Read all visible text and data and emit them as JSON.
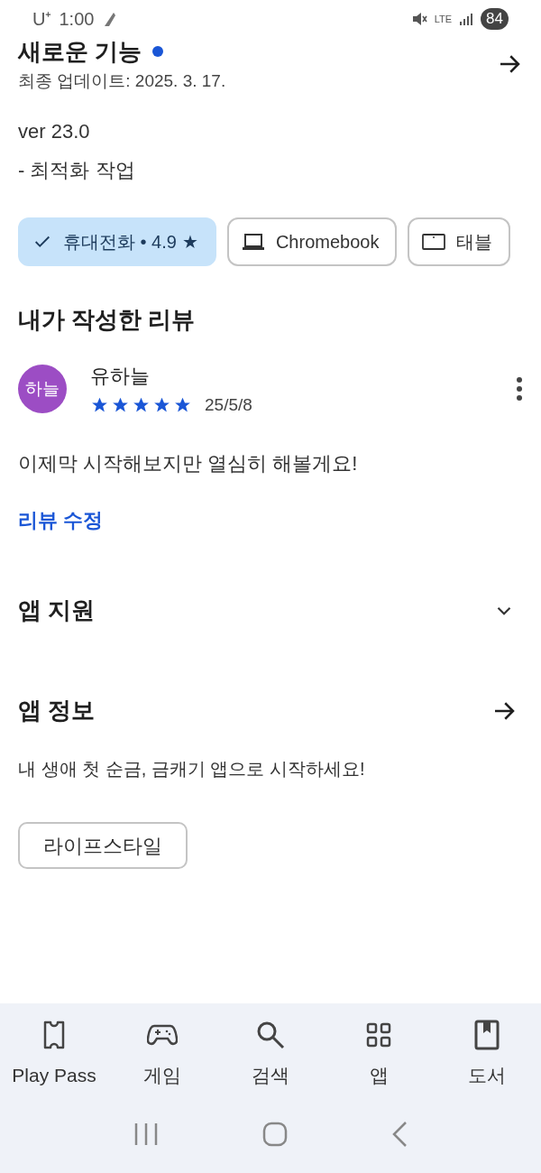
{
  "status_bar": {
    "carrier": "U⁺",
    "time": "1:00",
    "network": "LTE",
    "battery": "84"
  },
  "whats_new": {
    "title": "새로운 기능",
    "unread": true,
    "updated": "최종 업데이트: 2025. 3. 17.",
    "version": "ver 23.0",
    "notes": "- 최적화 작업"
  },
  "devices": [
    {
      "kind": "phone",
      "label": "휴대전화 • 4.9",
      "rating_star": "★",
      "selected": true
    },
    {
      "kind": "laptop",
      "label": "Chromebook",
      "selected": false
    },
    {
      "kind": "tablet",
      "label": "태블",
      "selected": false
    }
  ],
  "my_review": {
    "heading": "내가 작성한 리뷰",
    "avatar": "하늘",
    "author": "유하늘",
    "stars": 5,
    "date": "25/5/8",
    "text": "이제막 시작해보지만 열심히 해볼게요!",
    "edit_link": "리뷰 수정"
  },
  "app_support": {
    "heading": "앱 지원",
    "expanded": false
  },
  "app_info": {
    "heading": "앱 정보",
    "description": "내 생애 첫 순금, 금캐기 앱으로 시작하세요!",
    "tag": "라이프스타일"
  },
  "bottom_nav": [
    {
      "kind": "pass",
      "label": "Play Pass",
      "selected": false
    },
    {
      "kind": "games",
      "label": "게임",
      "selected": false
    },
    {
      "kind": "search",
      "label": "검색",
      "selected": false
    },
    {
      "kind": "apps",
      "label": "앱",
      "selected": false
    },
    {
      "kind": "books",
      "label": "도서",
      "selected": false
    }
  ]
}
